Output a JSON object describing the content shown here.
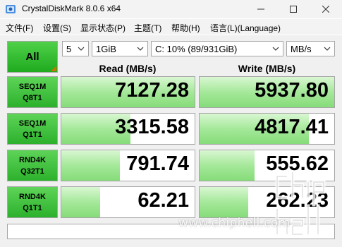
{
  "window": {
    "title": "CrystalDiskMark 8.0.6 x64",
    "minimize_glyph": "—",
    "maximize_glyph": "☐",
    "close_glyph": "✕"
  },
  "menu": [
    "文件(F)",
    "设置(S)",
    "显示状态(P)",
    "主题(T)",
    "帮助(H)",
    "语言(L)(Language)"
  ],
  "controls": {
    "all_label": "All",
    "count": "5",
    "size": "1GiB",
    "drive": "C: 10% (89/931GiB)",
    "unit": "MB/s"
  },
  "headers": {
    "read": "Read (MB/s)",
    "write": "Write (MB/s)"
  },
  "tests": [
    {
      "line1": "SEQ1M",
      "line2": "Q8T1",
      "read": "7127.28",
      "write": "5937.80",
      "read_fill": 1.0,
      "write_fill": 1.0
    },
    {
      "line1": "SEQ1M",
      "line2": "Q1T1",
      "read": "3315.58",
      "write": "4817.41",
      "read_fill": 0.52,
      "write_fill": 0.81
    },
    {
      "line1": "RND4K",
      "line2": "Q32T1",
      "read": "791.74",
      "write": "555.62",
      "read_fill": 0.44,
      "write_fill": 0.41
    },
    {
      "line1": "RND4K",
      "line2": "Q1T1",
      "read": "62.21",
      "write": "262.23",
      "read_fill": 0.29,
      "write_fill": 0.36
    }
  ],
  "status_text": "",
  "watermark": "www.chiphell.com",
  "colors": {
    "accent_green": "#1faa1f",
    "bar_green": "#a5e89a"
  },
  "icons": {
    "app": "crystaldiskmark-icon",
    "logo": "chiphell-logo"
  }
}
